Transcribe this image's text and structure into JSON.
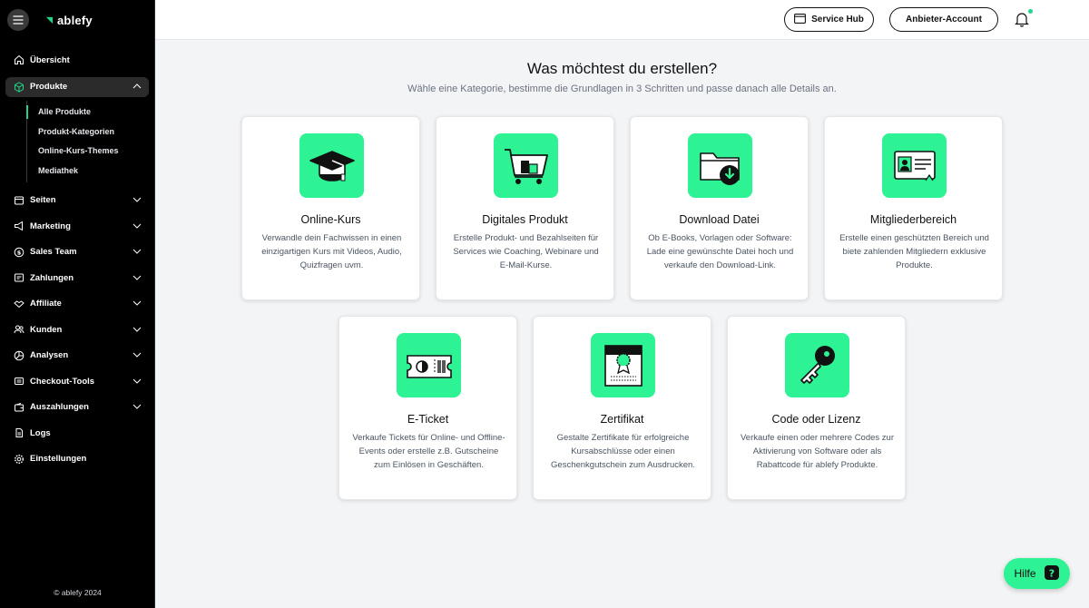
{
  "brand": {
    "name": "ablefy",
    "accent": "#2ef394",
    "copyright": "© ablefy 2024"
  },
  "sidebar": {
    "items": [
      {
        "label": "Übersicht",
        "icon": "home-icon"
      },
      {
        "label": "Produkte",
        "icon": "box-icon",
        "expanded": true,
        "children": [
          "Alle Produkte",
          "Produkt-Kategorien",
          "Online-Kurs-Themes",
          "Mediathek"
        ]
      },
      {
        "label": "Seiten",
        "icon": "layout-icon"
      },
      {
        "label": "Marketing",
        "icon": "megaphone-icon"
      },
      {
        "label": "Sales Team",
        "icon": "dollar-icon"
      },
      {
        "label": "Zahlungen",
        "icon": "receipt-icon"
      },
      {
        "label": "Affiliate",
        "icon": "handshake-icon"
      },
      {
        "label": "Kunden",
        "icon": "users-icon"
      },
      {
        "label": "Analysen",
        "icon": "chart-pie-icon"
      },
      {
        "label": "Checkout-Tools",
        "icon": "cart-tool-icon"
      },
      {
        "label": "Auszahlungen",
        "icon": "wallet-icon"
      },
      {
        "label": "Logs",
        "icon": "log-icon"
      },
      {
        "label": "Einstellungen",
        "icon": "gear-icon"
      }
    ]
  },
  "topbar": {
    "service_hub": "Service Hub",
    "account": "Anbieter-Account"
  },
  "main": {
    "title": "Was möchtest du erstellen?",
    "subtitle": "Wähle eine Kategorie, bestimme die Grundlagen in 3 Schritten und passe danach alle Details an.",
    "cards": [
      {
        "title": "Online-Kurs",
        "desc": "Verwandle dein Fachwissen in einen einzigartigen Kurs mit Videos, Audio, Quizfragen uvm.",
        "icon": "graduation-cap-icon"
      },
      {
        "title": "Digitales Produkt",
        "desc": "Erstelle Produkt- und Bezahlseiten für Services wie Coaching, Webinare und E-Mail-Kurse.",
        "icon": "shopping-cart-icon"
      },
      {
        "title": "Download Datei",
        "desc": "Ob E-Books, Vorlagen oder Software: Lade eine gewünschte Datei hoch und verkaufe den Download-Link.",
        "icon": "folder-download-icon"
      },
      {
        "title": "Mitgliederbereich",
        "desc": "Erstelle einen geschützten Bereich und biete zahlenden Mitgliedern exklusive Produkte.",
        "icon": "member-card-icon"
      },
      {
        "title": "E-Ticket",
        "desc": "Verkaufe Tickets für Online- und Offline-Events oder erstelle z.B. Gutscheine zum Einlösen in Geschäften.",
        "icon": "ticket-icon"
      },
      {
        "title": "Zertifikat",
        "desc": "Gestalte Zertifikate für erfolgreiche Kursabschlüsse oder einen Geschenkgutschein zum Ausdrucken.",
        "icon": "certificate-icon"
      },
      {
        "title": "Code oder Lizenz",
        "desc": "Verkaufe einen oder mehrere Codes zur Aktivierung von Software oder als Rabattcode für ablefy Produkte.",
        "icon": "key-icon"
      }
    ]
  },
  "help": {
    "label": "Hilfe"
  }
}
